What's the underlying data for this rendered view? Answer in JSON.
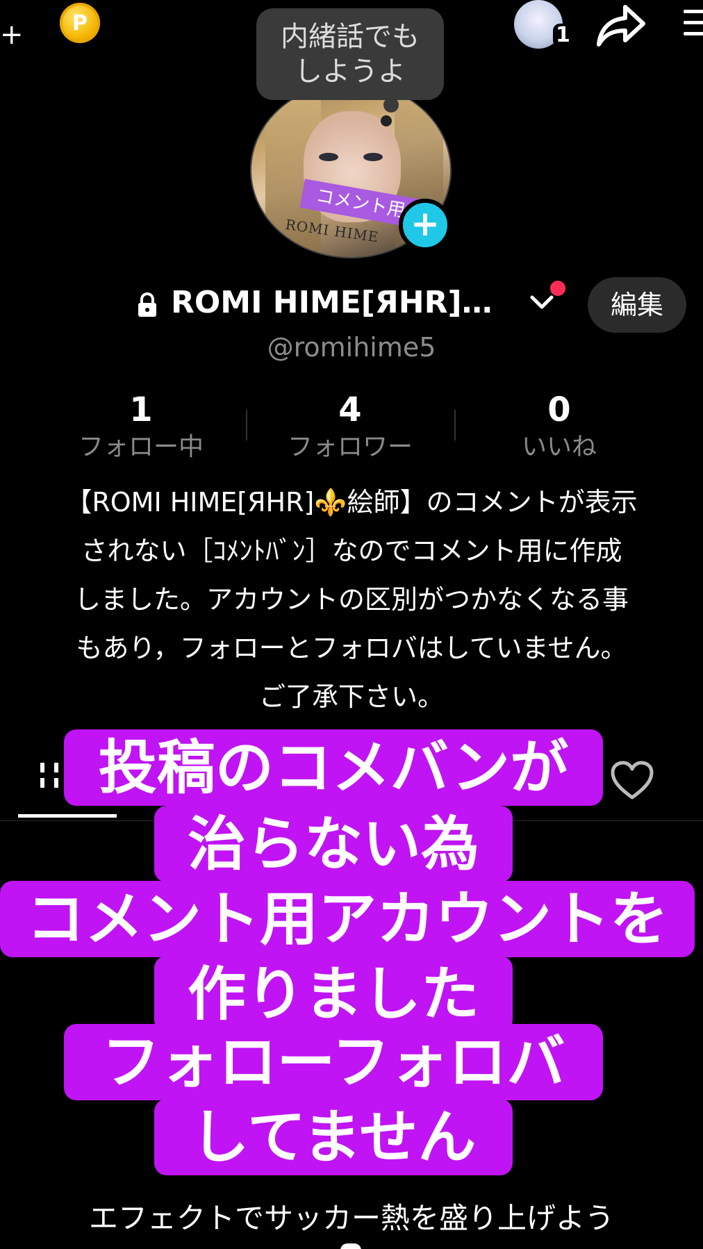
{
  "top_bar": {
    "add_label": "+",
    "coin_label": "P",
    "friend_count": "1"
  },
  "bubble": {
    "text_line1": "内緒話でも",
    "text_line2": "しようよ"
  },
  "avatar": {
    "tag_text": "コメント用",
    "name_text": "ROMI HIME"
  },
  "profile": {
    "name": "ROMI HIME[ЯHR]…",
    "handle": "@romihime5",
    "edit_label": "編集"
  },
  "stats": [
    {
      "value": "1",
      "label": "フォロー中"
    },
    {
      "value": "4",
      "label": "フォロワー"
    },
    {
      "value": "0",
      "label": "いいね"
    }
  ],
  "bio": {
    "line1": "【ROMI HIME[ЯHR]⚜️絵師】のコメントが表示",
    "line2": "されない［ｺﾒﾝﾄﾊﾞﾝ］なのでコメント用に作成",
    "line3": "しました。アカウントの区別がつかなくなる事",
    "line4": "もあり，フォローとフォロバはしていません。",
    "line5": "ご了承下さい。"
  },
  "overlay": {
    "line1": "投稿のコメバンが",
    "line2": "治らない為",
    "line3": "コメント用アカウントを",
    "line4": "作りました",
    "line5": "フォローフォロバ",
    "line6": "してません"
  },
  "footer": {
    "effect_text": "エフェクトでサッカー熱を盛り上げよう"
  },
  "colors": {
    "overlay": "#c014f5",
    "plus_badge": "#20c8e8",
    "notify_dot": "#ff2d55",
    "background": "#000000"
  }
}
